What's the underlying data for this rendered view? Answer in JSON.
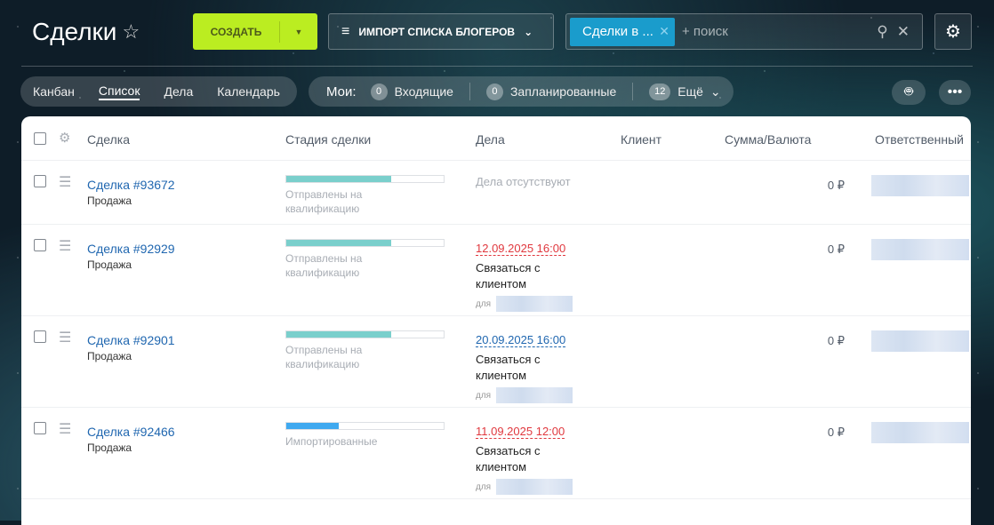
{
  "header": {
    "title": "Сделки",
    "create_label": "СОЗДАТЬ",
    "import_label": "ИМПОРТ СПИСКА БЛОГЕРОВ",
    "filter_chip": "Сделки в ...",
    "search_placeholder": "+ поиск"
  },
  "views": [
    {
      "label": "Канбан",
      "active": false
    },
    {
      "label": "Список",
      "active": true
    },
    {
      "label": "Дела",
      "active": false
    },
    {
      "label": "Календарь",
      "active": false
    }
  ],
  "counters": {
    "label": "Мои:",
    "items": [
      {
        "count": "0",
        "label": "Входящие"
      },
      {
        "count": "0",
        "label": "Запланированные"
      },
      {
        "count": "12",
        "label": "Ещё"
      }
    ]
  },
  "columns": [
    "Сделка",
    "Стадия сделки",
    "Дела",
    "Клиент",
    "Сумма/Валюта",
    "Ответственный"
  ],
  "colors": {
    "accent": "#bbed21",
    "stage_teal": "#7acfcc",
    "stage_blue": "#3fa9f0",
    "overdue": "#e0383e",
    "link": "#2067b0"
  },
  "rows": [
    {
      "deal": "Сделка #93672",
      "type": "Продажа",
      "stage": "Отправлены на квалификацию",
      "stage_progress": 0.667,
      "stage_color": "#7acfcc",
      "activity_empty": "Дела отсутствуют",
      "date": "",
      "date_color": "",
      "action": "",
      "for": "",
      "sum": "0 ₽"
    },
    {
      "deal": "Сделка #92929",
      "type": "Продажа",
      "stage": "Отправлены на квалификацию",
      "stage_progress": 0.667,
      "stage_color": "#7acfcc",
      "activity_empty": "",
      "date": "12.09.2025 16:00",
      "date_color": "#e0383e",
      "action": "Связаться с клиентом",
      "for": "для",
      "sum": "0 ₽"
    },
    {
      "deal": "Сделка #92901",
      "type": "Продажа",
      "stage": "Отправлены на квалификацию",
      "stage_progress": 0.667,
      "stage_color": "#7acfcc",
      "activity_empty": "",
      "date": "20.09.2025 16:00",
      "date_color": "#2067b0",
      "action": "Связаться с клиентом",
      "for": "для",
      "sum": "0 ₽"
    },
    {
      "deal": "Сделка #92466",
      "type": "Продажа",
      "stage": "Импортированные",
      "stage_progress": 0.333,
      "stage_color": "#3fa9f0",
      "activity_empty": "",
      "date": "11.09.2025 12:00",
      "date_color": "#e0383e",
      "action": "Связаться с клиентом",
      "for": "для",
      "sum": "0 ₽"
    }
  ]
}
